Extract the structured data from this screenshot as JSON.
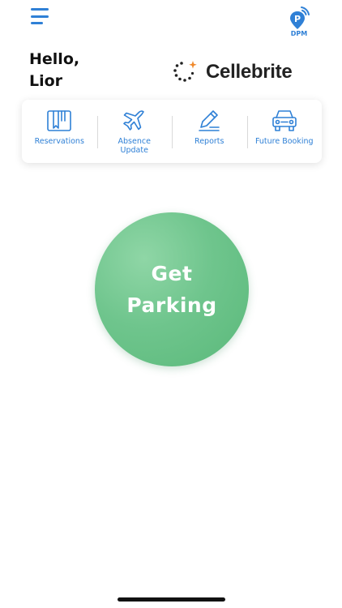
{
  "header": {
    "menu_icon": "hamburger-menu-icon",
    "app_badge": {
      "icon": "parking-pin-icon",
      "label": "DPM",
      "color": "#2f80d6"
    }
  },
  "greeting": {
    "line1": "Hello,",
    "line2": "Lior"
  },
  "brand": {
    "logo_icon": "cellebrite-dots-icon",
    "name": "Cellebrite",
    "accent": "#f08a2c"
  },
  "quick_nav": [
    {
      "icon": "reservations-icon",
      "label": "Reservations"
    },
    {
      "icon": "airplane-icon",
      "label_line1": "Absence",
      "label_line2": "Update"
    },
    {
      "icon": "reports-pencil-icon",
      "label": "Reports"
    },
    {
      "icon": "car-icon",
      "label": "Future Booking"
    }
  ],
  "cta": {
    "line1": "Get",
    "line2": "Parking",
    "color": "#6fc58d"
  },
  "colors": {
    "accent": "#2f80d6",
    "text": "#111111",
    "background": "#ffffff"
  }
}
